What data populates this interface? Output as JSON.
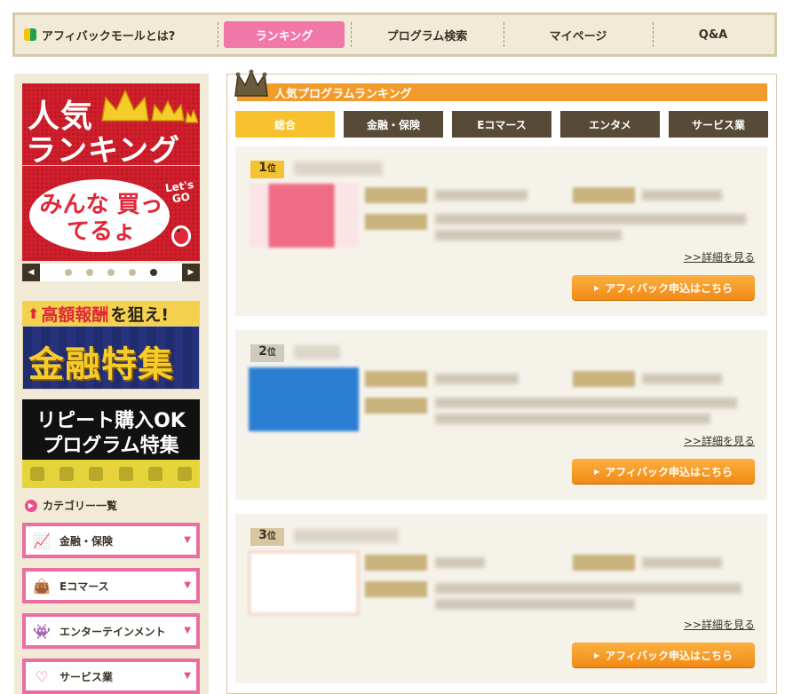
{
  "nav": {
    "about": "アフィバックモールとは?",
    "ranking": "ランキング",
    "search": "プログラム検索",
    "mypage": "マイページ",
    "qa": "Q&A"
  },
  "sidebar": {
    "ranking_banner": {
      "line1": "人気",
      "line2": "ランキング",
      "bubble": "みんな 買ってるょ",
      "lets": "Let's GO"
    },
    "carousel": {
      "dot_count": 5,
      "active_index": 4
    },
    "kinyu_banner": {
      "sub_prefix": "高額報酬",
      "sub_suffix": "を狙え!",
      "main": "金融特集"
    },
    "repeat_banner": {
      "line1": "リピート購入OK",
      "line2": "プログラム特集"
    },
    "category_heading": "カテゴリー一覧",
    "categories": [
      {
        "label": "金融・保険",
        "icon": "chart-icon"
      },
      {
        "label": "Eコマース",
        "icon": "shopping-bag-icon"
      },
      {
        "label": "エンターテインメント",
        "icon": "invader-icon"
      },
      {
        "label": "サービス業",
        "icon": "heart-icon"
      }
    ]
  },
  "main": {
    "heading": "人気プログラムランキング",
    "tabs": [
      "総合",
      "金融・保険",
      "Eコマース",
      "エンタメ",
      "サービス業"
    ],
    "active_tab": 0,
    "cards": [
      {
        "rank_num": "1",
        "rank_unit": "位",
        "detail": ">>詳細を見る",
        "apply": "アフィバック申込はこちら"
      },
      {
        "rank_num": "2",
        "rank_unit": "位",
        "detail": ">>詳細を見る",
        "apply": "アフィバック申込はこちら"
      },
      {
        "rank_num": "3",
        "rank_unit": "位",
        "detail": ">>詳細を見る",
        "apply": "アフィバック申込はこちら"
      }
    ]
  },
  "colors": {
    "nav_bg": "#f1ead7",
    "ranking_pill": "#f178a8",
    "heading_orange": "#f29b2a",
    "tab_dark": "#574a37",
    "tab_active": "#f6c12d",
    "category_border": "#ec6ea0",
    "apply_button": "#f28a15"
  }
}
